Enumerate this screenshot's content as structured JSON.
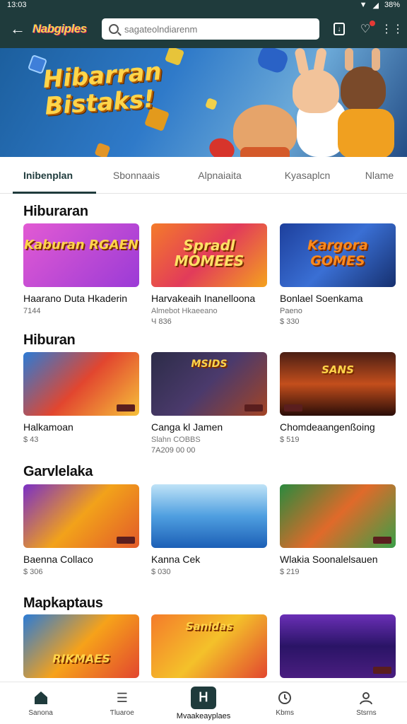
{
  "status": {
    "time": "13:03",
    "battery": "38%"
  },
  "app": {
    "logo": "Nabgiples",
    "search_placeholder": "sagateolndiarenm"
  },
  "banner": {
    "title_line1": "Hibarran",
    "title_line2": "Bistaks!"
  },
  "tabs": [
    {
      "label": "Inibenplan",
      "active": true
    },
    {
      "label": "Sbonnaais",
      "active": false
    },
    {
      "label": "Alpnaiaita",
      "active": false
    },
    {
      "label": "Kyasaplcn",
      "active": false
    },
    {
      "label": "Nlame",
      "active": false
    }
  ],
  "sections": [
    {
      "title": "Hiburaran",
      "cards": [
        {
          "thumb_title": "Kaburan RGAEN",
          "name": "Haarano Duta Hkaderin",
          "sub": "7144",
          "price": ""
        },
        {
          "thumb_title": "Spradl MOMEES",
          "name": "Harvakeaih Inanelloona",
          "sub": "Almebot Hkaeeano",
          "price": "Ч 836"
        },
        {
          "thumb_title": "Kargora GOMES",
          "name": "Bonlael Soenkama",
          "sub": "Paeno",
          "price": "$ 330"
        }
      ]
    },
    {
      "title": "Hiburan",
      "cards": [
        {
          "thumb_title": "",
          "name": "Halkamoan",
          "sub": "$ 43",
          "price": ""
        },
        {
          "thumb_title": "MSIDS",
          "name": "Canga kl Jamen",
          "sub": "Slahn COBBS",
          "price": "7A209 00 00"
        },
        {
          "thumb_title": "SANS",
          "name": "Chomdeaangenßoing",
          "sub": "$ 519",
          "price": ""
        }
      ]
    },
    {
      "title": "Garvlelaka",
      "cards": [
        {
          "thumb_title": "",
          "name": "Baenna Collaco",
          "sub": "$ 306",
          "price": ""
        },
        {
          "thumb_title": "",
          "name": "Kanna Cek",
          "sub": "$ 030",
          "price": ""
        },
        {
          "thumb_title": "",
          "name": "Wlakia Soonalelsauen",
          "sub": "$ 219",
          "price": ""
        }
      ]
    },
    {
      "title": "Mapkaptaus",
      "cards": [
        {
          "thumb_title": "RIKMAES",
          "name": "",
          "sub": "",
          "price": ""
        },
        {
          "thumb_title": "Sanidas",
          "name": "",
          "sub": "",
          "price": ""
        },
        {
          "thumb_title": "",
          "name": "",
          "sub": "",
          "price": ""
        }
      ]
    }
  ],
  "bottom_nav": [
    {
      "label": "Sanona",
      "icon": "home-icon"
    },
    {
      "label": "Ƭluaroe",
      "icon": "list-icon"
    },
    {
      "label": "Mvaakeayplaes",
      "icon": "apps-icon"
    },
    {
      "label": "Kbms",
      "icon": "clock-icon"
    },
    {
      "label": "Stsrns",
      "icon": "profile-icon"
    }
  ],
  "colors": {
    "appbar": "#1f3b3c",
    "accent": "#1f3b3c"
  }
}
